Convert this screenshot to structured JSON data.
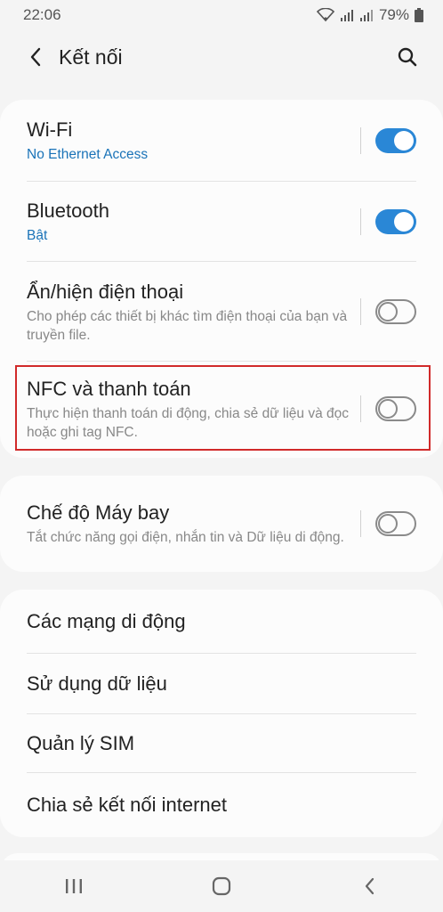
{
  "status": {
    "time": "22:06",
    "battery": "79%"
  },
  "header": {
    "title": "Kết nối"
  },
  "group1": [
    {
      "label": "Wi-Fi",
      "sub": "No Ethernet Access",
      "sub_style": "blue",
      "toggle": true
    },
    {
      "label": "Bluetooth",
      "sub": "Bật",
      "sub_style": "blue",
      "toggle": true
    },
    {
      "label": "Ẩn/hiện điện thoại",
      "sub": "Cho phép các thiết bị khác tìm điện thoại của bạn và truyền file.",
      "sub_style": "grey",
      "toggle": false
    },
    {
      "label": "NFC và thanh toán",
      "sub": "Thực hiện thanh toán di động, chia sẻ dữ liệu và đọc hoặc ghi tag NFC.",
      "sub_style": "grey",
      "toggle": false
    }
  ],
  "group2": [
    {
      "label": "Chế độ Máy bay",
      "sub": "Tắt chức năng gọi điện, nhắn tin và Dữ liệu di động.",
      "sub_style": "grey",
      "toggle": false
    }
  ],
  "group3": [
    {
      "label": "Các mạng di động"
    },
    {
      "label": "Sử dụng dữ liệu"
    },
    {
      "label": "Quản lý SIM"
    },
    {
      "label": "Chia sẻ kết nối internet"
    }
  ],
  "icons": {
    "back": "chevron-left-icon",
    "search": "search-icon",
    "nav_recents": "recents-icon",
    "nav_home": "home-icon",
    "nav_back": "back-icon"
  },
  "colors": {
    "accent": "#2a87d6",
    "highlight": "#d12a2a"
  }
}
